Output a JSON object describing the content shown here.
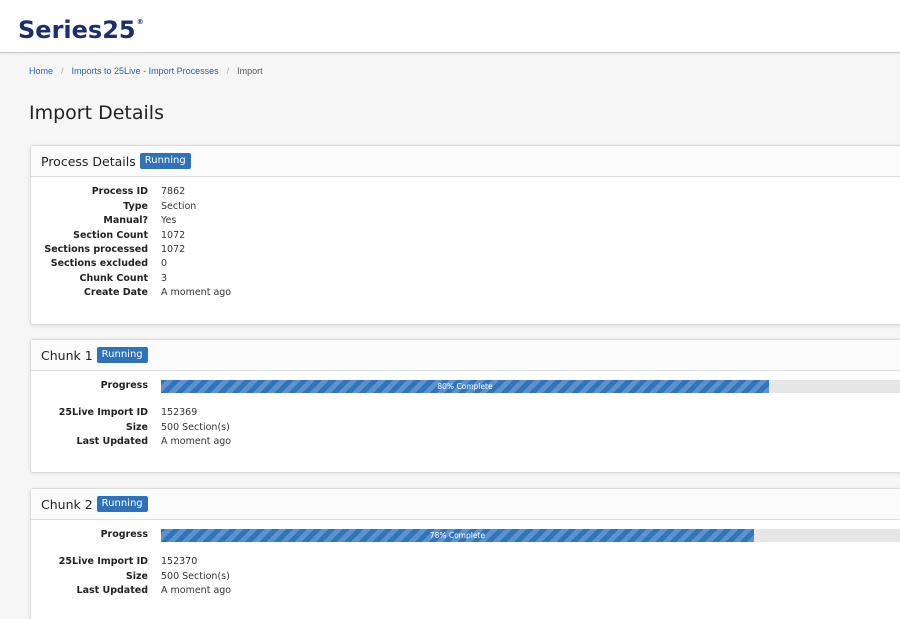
{
  "header": {
    "logo_text": "Series25",
    "logo_mark": "®"
  },
  "breadcrumb": [
    {
      "label": "Home"
    },
    {
      "label": "Imports to 25Live - Import Processes"
    },
    {
      "label": "Import"
    }
  ],
  "page_title": "Import Details",
  "process_details": {
    "title": "Process Details",
    "status": "Running",
    "fields": [
      {
        "label": "Process ID",
        "value": "7862"
      },
      {
        "label": "Type",
        "value": "Section"
      },
      {
        "label": "Manual?",
        "value": "Yes"
      },
      {
        "label": "Section Count",
        "value": "1072"
      },
      {
        "label": "Sections processed",
        "value": "1072"
      },
      {
        "label": "Sections excluded",
        "value": "0"
      },
      {
        "label": "Chunk Count",
        "value": "3"
      },
      {
        "label": "Create Date",
        "value": "A moment ago"
      }
    ]
  },
  "chunks": [
    {
      "title": "Chunk 1",
      "status": "Running",
      "progress_label": "Progress",
      "progress_percent": 80,
      "progress_text": "80% Complete",
      "fields": [
        {
          "label": "25Live Import ID",
          "value": "152369"
        },
        {
          "label": "Size",
          "value": "500 Section(s)"
        },
        {
          "label": "Last Updated",
          "value": "A moment ago"
        }
      ]
    },
    {
      "title": "Chunk 2",
      "status": "Running",
      "progress_label": "Progress",
      "progress_percent": 78,
      "progress_text": "78% Complete",
      "fields": [
        {
          "label": "25Live Import ID",
          "value": "152370"
        },
        {
          "label": "Size",
          "value": "500 Section(s)"
        },
        {
          "label": "Last Updated",
          "value": "A moment ago"
        }
      ]
    }
  ],
  "colors": {
    "brand": "#1b2f6e",
    "badge": "#2e72ba",
    "link": "#2b62a8",
    "progress": "#2f74bc"
  }
}
